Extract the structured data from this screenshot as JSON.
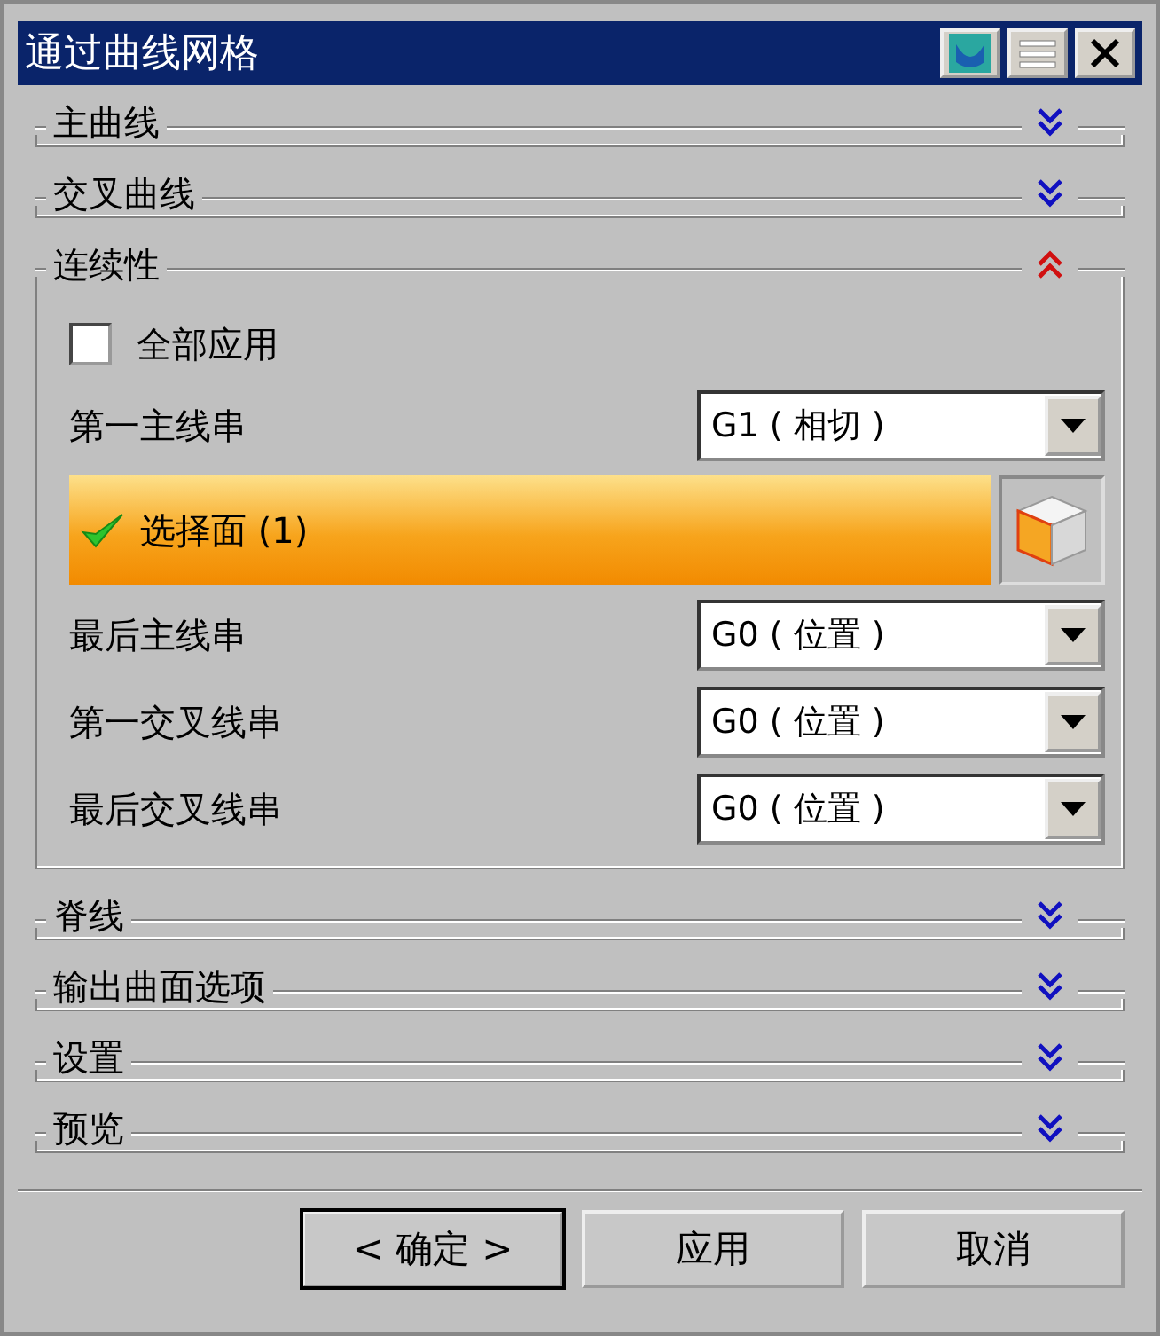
{
  "window": {
    "title": "通过曲线网格"
  },
  "sections": [
    {
      "title": "主曲线",
      "expanded": false
    },
    {
      "title": "交叉曲线",
      "expanded": false
    },
    {
      "title": "连续性",
      "expanded": true,
      "apply_all": {
        "label": "全部应用",
        "checked": false
      },
      "rows": [
        {
          "kind": "dropdown",
          "label": "第一主线串",
          "value": "G1 ( 相切 )"
        },
        {
          "kind": "selection",
          "label": "选择面 (1)",
          "done": true
        },
        {
          "kind": "dropdown",
          "label": "最后主线串",
          "value": "G0 ( 位置 )"
        },
        {
          "kind": "dropdown",
          "label": "第一交叉线串",
          "value": "G0 ( 位置 )"
        },
        {
          "kind": "dropdown",
          "label": "最后交叉线串",
          "value": "G0 ( 位置 )"
        }
      ]
    },
    {
      "title": "脊线",
      "expanded": false
    },
    {
      "title": "输出曲面选项",
      "expanded": false
    },
    {
      "title": "设置",
      "expanded": false
    },
    {
      "title": "预览",
      "expanded": false
    }
  ],
  "buttons": [
    {
      "label": "< 确定 >",
      "default": true
    },
    {
      "label": "应用",
      "default": false
    },
    {
      "label": "取消",
      "default": false
    }
  ]
}
